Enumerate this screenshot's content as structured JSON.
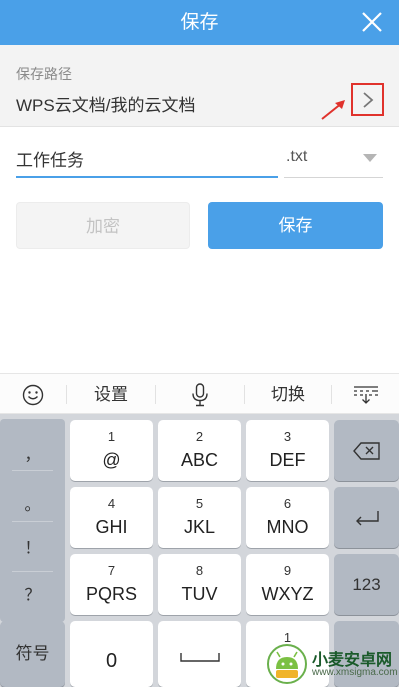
{
  "header": {
    "title": "保存"
  },
  "save_path": {
    "label": "保存路径",
    "value": "WPS云文档/我的云文档"
  },
  "file": {
    "name": "工作任务",
    "extension": ".txt"
  },
  "buttons": {
    "encrypt": "加密",
    "save": "保存"
  },
  "keyboard": {
    "toolbar": {
      "settings": "设置",
      "switch": "切换"
    },
    "punctuation": [
      "，",
      "。",
      "！",
      "？"
    ],
    "keys": [
      {
        "num": "1",
        "letters": "@"
      },
      {
        "num": "2",
        "letters": "ABC"
      },
      {
        "num": "3",
        "letters": "DEF"
      },
      {
        "num": "4",
        "letters": "GHI"
      },
      {
        "num": "5",
        "letters": "JKL"
      },
      {
        "num": "6",
        "letters": "MNO"
      },
      {
        "num": "7",
        "letters": "PQRS"
      },
      {
        "num": "8",
        "letters": "TUV"
      },
      {
        "num": "9",
        "letters": "WXYZ"
      }
    ],
    "numbers_key": "123",
    "symbols_key": "符号",
    "zero_key": "0",
    "bottom_right_num": "1"
  },
  "watermark": {
    "title": "小麦安卓网",
    "url": "www.xmsigma.com"
  },
  "colors": {
    "accent": "#4aa0e8",
    "highlight": "#e0322c"
  }
}
